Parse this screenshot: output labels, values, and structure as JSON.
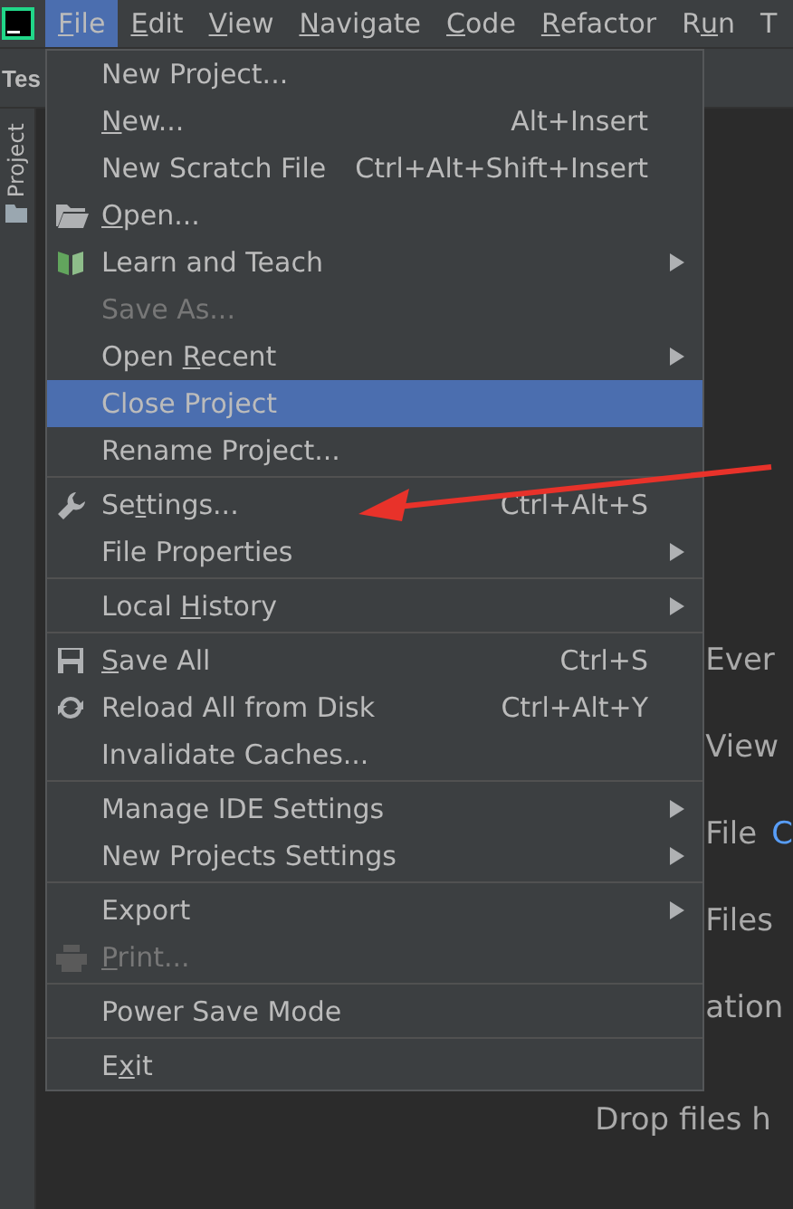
{
  "menubar": [
    {
      "label": "File",
      "selected": true
    },
    {
      "label": "Edit",
      "selected": false
    },
    {
      "label": "View",
      "selected": false
    },
    {
      "label": "Navigate",
      "selected": false
    },
    {
      "label": "Code",
      "selected": false
    },
    {
      "label": "Refactor",
      "selected": false
    },
    {
      "label": "Run",
      "selected": false
    },
    {
      "label": "T",
      "selected": false
    }
  ],
  "project_title": "Tes",
  "tool_window_tab": "Project",
  "editor_hints": [
    {
      "text": "Ever",
      "kind": "behind_menu"
    },
    {
      "text": "View",
      "kind": "behind_menu"
    },
    {
      "text": "File",
      "kind": "behind_menu",
      "shortcut_hint": "C"
    },
    {
      "text": "Files",
      "kind": "behind_menu"
    },
    {
      "text": "ation",
      "kind": "behind_menu"
    },
    {
      "text": "Drop files h",
      "kind": "clear"
    }
  ],
  "file_menu": [
    {
      "kind": "item",
      "label": "New Project...",
      "disabled": false,
      "selected": false,
      "submenu": false
    },
    {
      "kind": "item",
      "label": "New...",
      "shortcut": "Alt+Insert",
      "disabled": false,
      "selected": false,
      "submenu": false
    },
    {
      "kind": "item",
      "label": "New Scratch File",
      "shortcut": "Ctrl+Alt+Shift+Insert",
      "disabled": false,
      "selected": false,
      "submenu": false
    },
    {
      "kind": "item",
      "label": "Open...",
      "disabled": false,
      "selected": false,
      "submenu": false
    },
    {
      "kind": "item",
      "label": "Learn and Teach",
      "disabled": false,
      "selected": false,
      "submenu": true
    },
    {
      "kind": "item",
      "label": "Save As...",
      "disabled": true,
      "selected": false,
      "submenu": false
    },
    {
      "kind": "item",
      "label": "Open Recent",
      "disabled": false,
      "selected": false,
      "submenu": true
    },
    {
      "kind": "item",
      "label": "Close Project",
      "disabled": false,
      "selected": true,
      "submenu": false
    },
    {
      "kind": "item",
      "label": "Rename Project...",
      "disabled": false,
      "selected": false,
      "submenu": false
    },
    {
      "kind": "separator"
    },
    {
      "kind": "item",
      "label": "Settings...",
      "shortcut": "Ctrl+Alt+S",
      "disabled": false,
      "selected": false,
      "submenu": false
    },
    {
      "kind": "item",
      "label": "File Properties",
      "disabled": false,
      "selected": false,
      "submenu": true
    },
    {
      "kind": "separator"
    },
    {
      "kind": "item",
      "label": "Local History",
      "disabled": false,
      "selected": false,
      "submenu": true
    },
    {
      "kind": "separator"
    },
    {
      "kind": "item",
      "label": "Save All",
      "shortcut": "Ctrl+S",
      "disabled": false,
      "selected": false,
      "submenu": false
    },
    {
      "kind": "item",
      "label": "Reload All from Disk",
      "shortcut": "Ctrl+Alt+Y",
      "disabled": false,
      "selected": false,
      "submenu": false
    },
    {
      "kind": "item",
      "label": "Invalidate Caches...",
      "disabled": false,
      "selected": false,
      "submenu": false
    },
    {
      "kind": "separator"
    },
    {
      "kind": "item",
      "label": "Manage IDE Settings",
      "disabled": false,
      "selected": false,
      "submenu": true
    },
    {
      "kind": "item",
      "label": "New Projects Settings",
      "disabled": false,
      "selected": false,
      "submenu": true
    },
    {
      "kind": "separator"
    },
    {
      "kind": "item",
      "label": "Export",
      "disabled": false,
      "selected": false,
      "submenu": true
    },
    {
      "kind": "item",
      "label": "Print...",
      "disabled": true,
      "selected": false,
      "submenu": false
    },
    {
      "kind": "separator"
    },
    {
      "kind": "item",
      "label": "Power Save Mode",
      "disabled": false,
      "selected": false,
      "submenu": false
    },
    {
      "kind": "separator"
    },
    {
      "kind": "item",
      "label": "Exit",
      "disabled": false,
      "selected": false,
      "submenu": false
    }
  ],
  "annotation": {
    "kind": "arrow"
  }
}
